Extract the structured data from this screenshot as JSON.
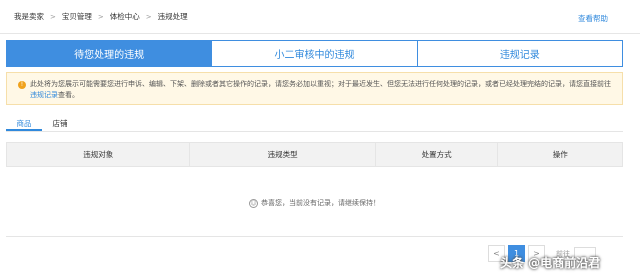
{
  "breadcrumb": [
    "我是卖家",
    "宝贝管理",
    "体检中心",
    "违规处理"
  ],
  "breadcrumb_separator": ">",
  "help_link": "查看帮助",
  "tabs": [
    {
      "label": "待您处理的违规",
      "active": true
    },
    {
      "label": "小二审核中的违规",
      "active": false
    },
    {
      "label": "违规记录",
      "active": false
    }
  ],
  "notice": {
    "icon": "warning-icon",
    "text_before": "此处将为您展示可能需要您进行申诉、编辑、下架、删除或者其它操作的记录，请您务必加以重视；对于最近发生、但您无法进行任何处理的记录，或者已经处理完结的记录，请您直接前往",
    "link": "违规记录",
    "text_after": "查看。"
  },
  "subtabs": [
    {
      "label": "商品",
      "active": true
    },
    {
      "label": "店铺",
      "active": false
    }
  ],
  "table": {
    "columns": [
      "违规对象",
      "违规类型",
      "处置方式",
      "操作"
    ]
  },
  "empty_state": {
    "icon": "smile-icon",
    "message": "恭喜您，当前没有记录，请继续保持！"
  },
  "pagination": {
    "prev": "<",
    "current": "1",
    "next": ">",
    "goto_label": "前往"
  },
  "watermark": "头条 @电商前沿君",
  "colors": {
    "accent": "#3f8ee0",
    "link": "#3089dc",
    "notice_bg": "#fff8e6",
    "warning": "#f0a21c"
  }
}
